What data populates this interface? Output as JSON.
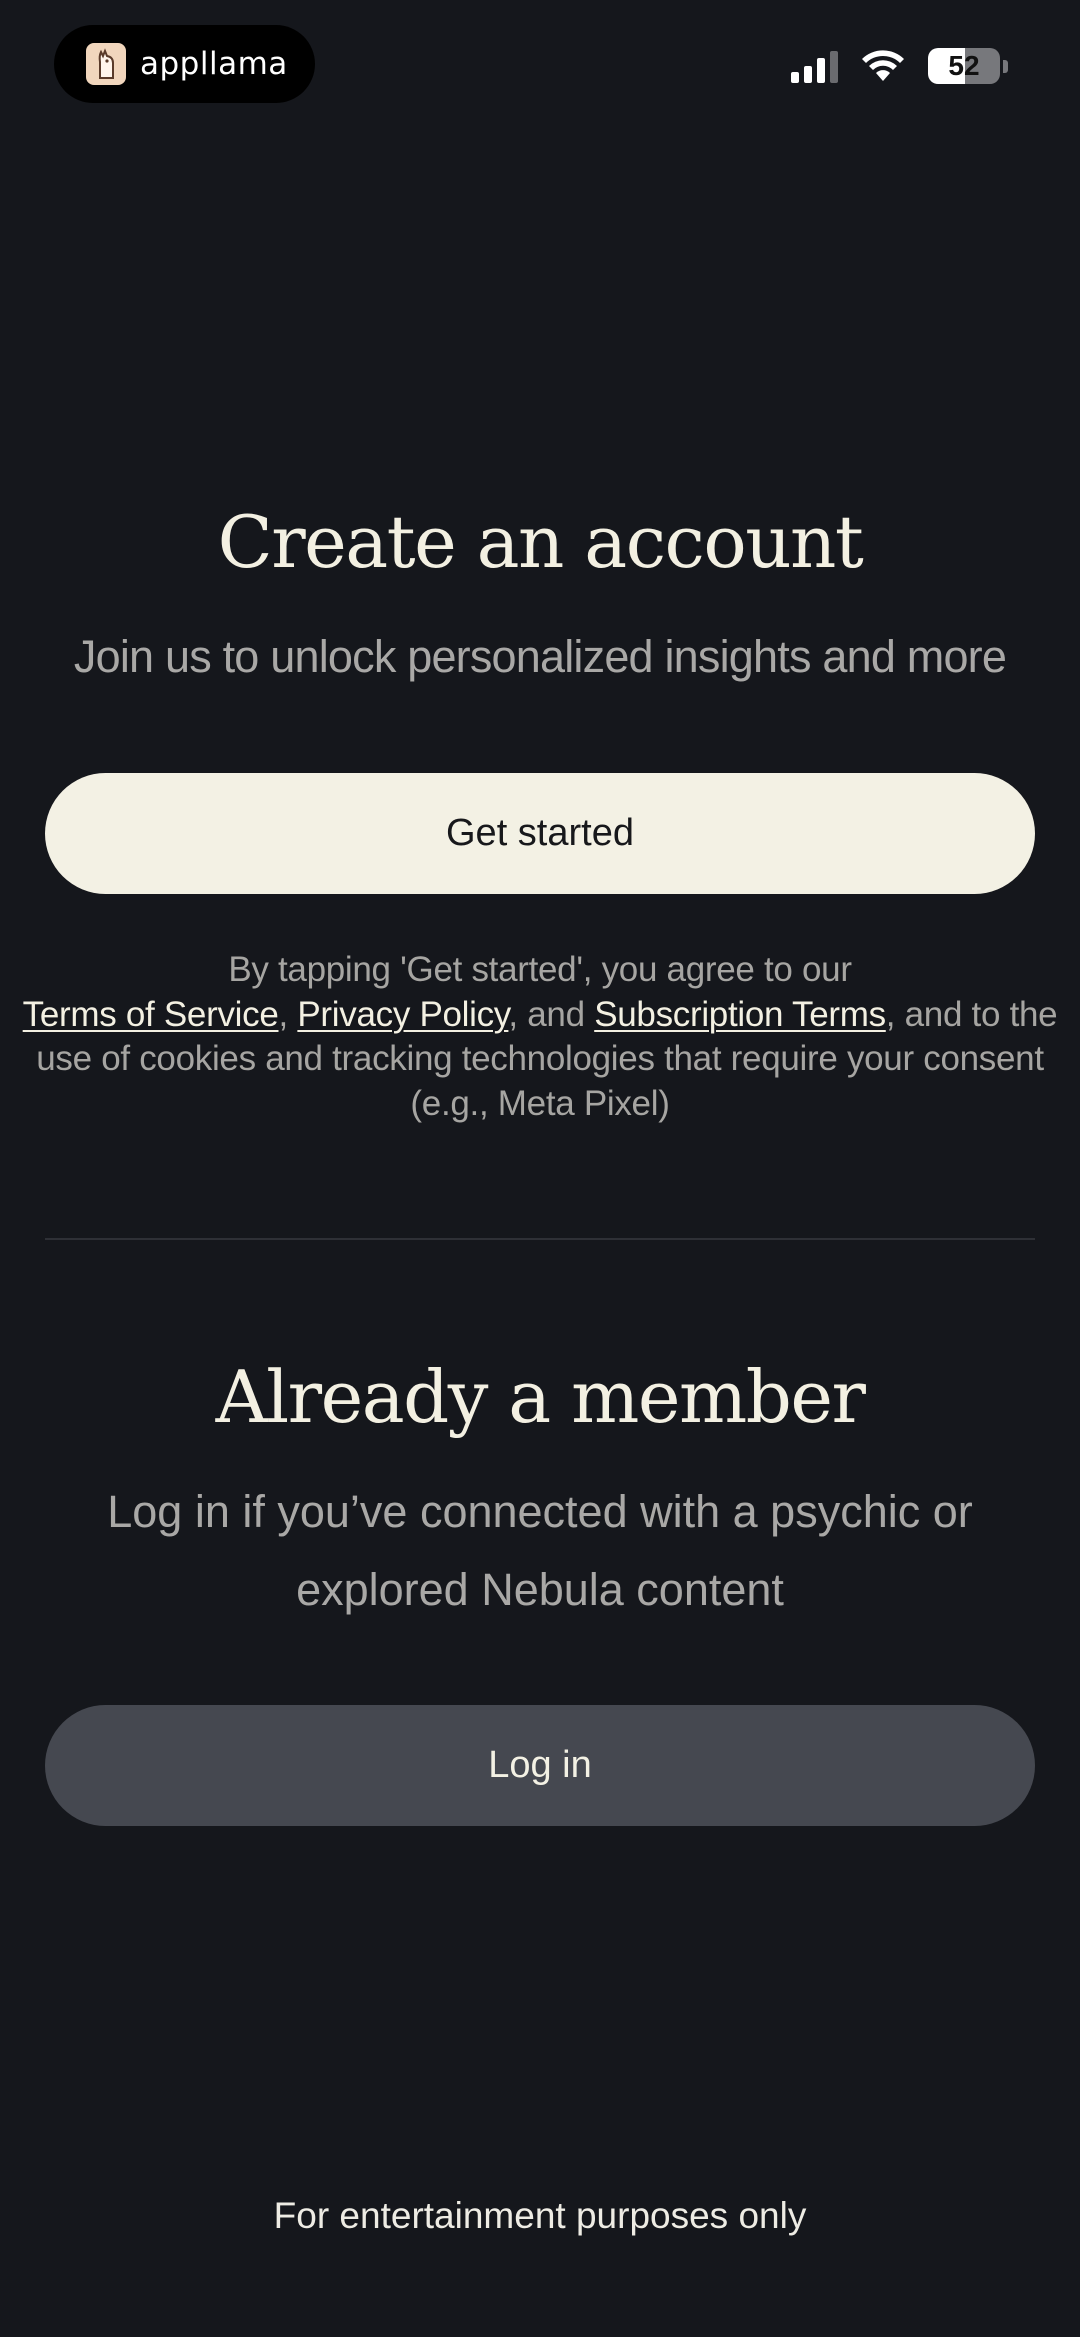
{
  "status_bar": {
    "app_pill_label": "appllama",
    "battery_level": "52",
    "battery_fraction": 0.52
  },
  "create_account": {
    "title": "Create an account",
    "subtitle": "Join us to unlock personalized insights and more",
    "get_started_label": "Get started"
  },
  "legal": {
    "intro": "By tapping 'Get started', you agree to our",
    "terms_link": "Terms of Service",
    "comma": ",",
    "privacy_link": "Privacy Policy",
    "and": ", and",
    "subscription_link": "Subscription Terms",
    "outro": ", and to the use of cookies and tracking technologies that require your consent (e.g., Meta Pixel)"
  },
  "member": {
    "title": "Already a member",
    "subtitle": "Log in if you’ve connected with a psychic or explored Nebula content",
    "login_label": "Log in"
  },
  "footer": {
    "note": "For entertainment purposes only"
  },
  "colors": {
    "background": "#15171c",
    "primary_button": "#f3f1e4",
    "secondary_button": "#454850",
    "heading": "#f3f0e2"
  }
}
